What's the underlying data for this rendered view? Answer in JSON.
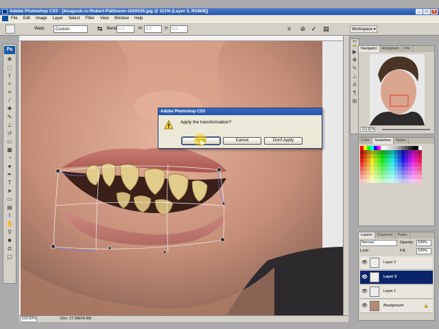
{
  "window": {
    "title": "Adobe Photoshop CS3 - [iknapsok.ru-Robert-Pattinson-1029155.jpg @ 111% (Layer 3, RGB/8)]"
  },
  "menu": [
    "File",
    "Edit",
    "Image",
    "Layer",
    "Select",
    "Filter",
    "View",
    "Window",
    "Help"
  ],
  "options": {
    "warp_label": "Warp:",
    "warp_value": "Custom",
    "bend_label": "Bend:",
    "bend_value": "0.0",
    "h_label": "H:",
    "h_value": "0.0",
    "v_label": "V:",
    "v_value": "0.0",
    "workspace_label": "Workspace"
  },
  "status": {
    "zoom": "110.82%",
    "doc": "Doc: 17.2M/24.9M"
  },
  "dialog": {
    "title": "Adobe Photoshop CS3",
    "message": "Apply the transformation?",
    "apply": "Apply",
    "cancel": "Cancel",
    "dont_apply": "Don't Apply"
  },
  "navigator": {
    "tabs": [
      "Navigator",
      "Histogram",
      "Info"
    ],
    "zoom": "110.82%"
  },
  "swatches": {
    "tabs": [
      "Color",
      "Swatches",
      "Styles"
    ]
  },
  "layers": {
    "tabs": [
      "Layers",
      "Channels",
      "Paths"
    ],
    "blend_mode": "Normal",
    "opacity_label": "Opacity:",
    "opacity_value": "100%",
    "lock_label": "Lock:",
    "fill_label": "Fill:",
    "fill_value": "100%",
    "items": [
      {
        "name": "Layer 2",
        "selected": false
      },
      {
        "name": "Layer 3",
        "selected": true
      },
      {
        "name": "Layer 1",
        "selected": false
      },
      {
        "name": "Background",
        "selected": false
      }
    ]
  },
  "colors": {
    "selection": "#0a246a",
    "titlebar": "#2456a8"
  }
}
